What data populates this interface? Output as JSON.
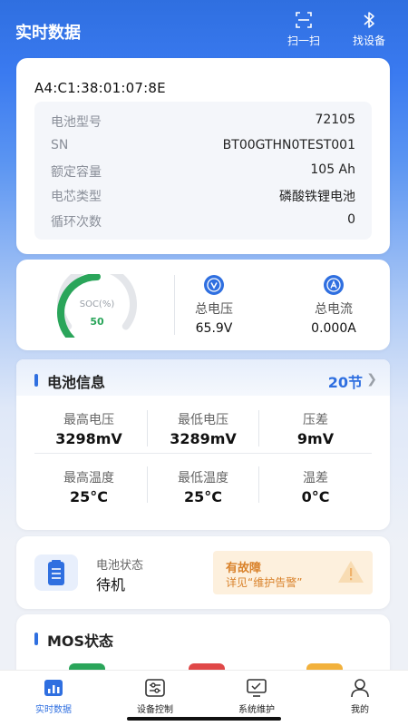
{
  "header": {
    "title": "实时数据",
    "scan_label": "扫一扫",
    "find_label": "找设备"
  },
  "device": {
    "mac": "A4:C1:38:01:07:8E",
    "rows": [
      {
        "label": "电池型号",
        "value": "72105"
      },
      {
        "label": "SN",
        "value": "BT00GTHN0TEST001"
      },
      {
        "label": "额定容量",
        "value": "105 Ah"
      },
      {
        "label": "电芯类型",
        "value": "磷酸铁锂电池"
      },
      {
        "label": "循环次数",
        "value": "0"
      }
    ]
  },
  "summary": {
    "soc_label": "SOC(%)",
    "soc_value": "50",
    "soc_percent": 50,
    "voltage_label": "总电压",
    "voltage_value": "65.9V",
    "current_label": "总电流",
    "current_value": "0.000A"
  },
  "battery_info": {
    "title": "电池信息",
    "cells": "20节",
    "stats": [
      {
        "label": "最高电压",
        "value": "3298mV"
      },
      {
        "label": "最低电压",
        "value": "3289mV"
      },
      {
        "label": "压差",
        "value": "9mV"
      },
      {
        "label": "最高温度",
        "value": "25°C"
      },
      {
        "label": "最低温度",
        "value": "25°C"
      },
      {
        "label": "温差",
        "value": "0°C"
      }
    ]
  },
  "battery_status": {
    "label": "电池状态",
    "value": "待机",
    "fault_title": "有故障",
    "fault_sub": "详见“维护告警”"
  },
  "mos": {
    "title": "MOS状态"
  },
  "tabs": [
    {
      "label": "实时数据",
      "active": true
    },
    {
      "label": "设备控制",
      "active": false
    },
    {
      "label": "系统维护",
      "active": false
    },
    {
      "label": "我的",
      "active": false
    }
  ],
  "colors": {
    "accent": "#2f6fe0",
    "soc_green": "#2aa55a",
    "fault_orange": "#d9822b"
  }
}
